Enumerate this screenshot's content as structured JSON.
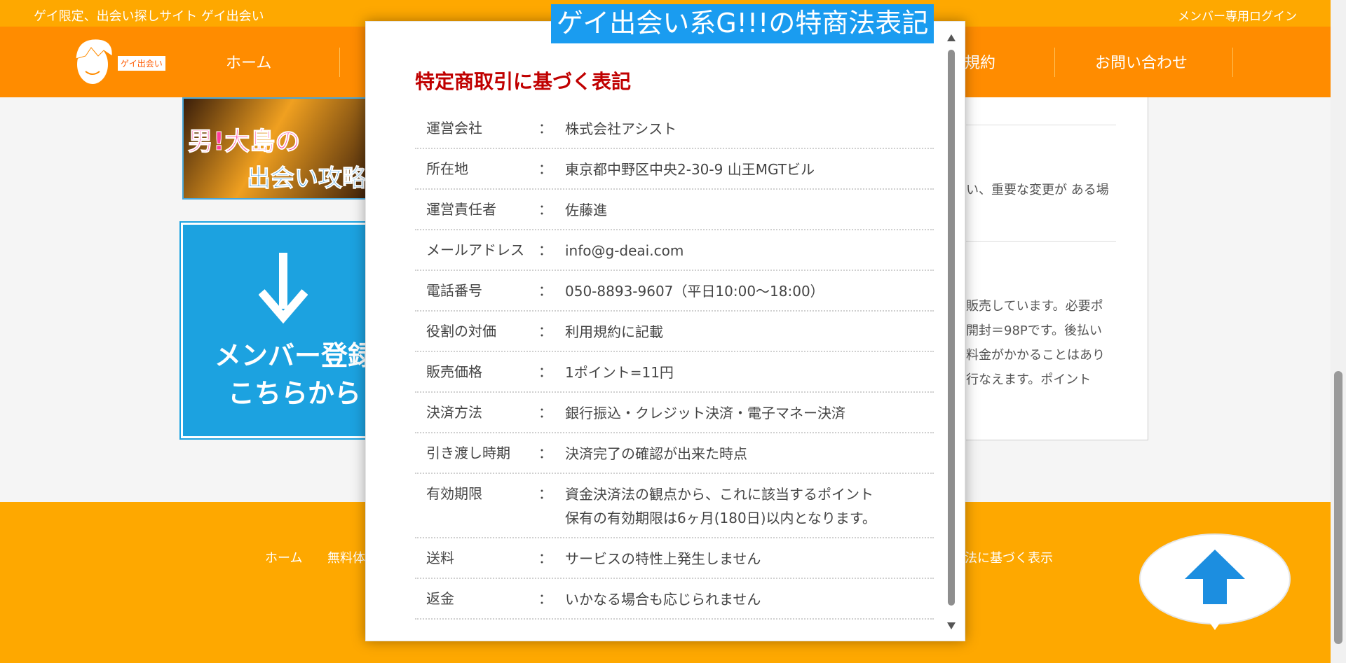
{
  "header": {
    "tagline": "ゲイ限定、出会い探しサイト ゲイ出会い",
    "member_login": "メンバー専用ログイン",
    "logo_label": "ゲイ出会い"
  },
  "nav": {
    "items": [
      "ホーム",
      "規約",
      "お問い合わせ"
    ]
  },
  "sidebar": {
    "banner1_line1": "男!大島の",
    "banner1_line2": "出会い攻略",
    "banner2_line1": "メンバー登録",
    "banner2_line2": "こちらから"
  },
  "content": {
    "line1": "い、重要な変更が ある場",
    "line2": "販売しています。必要ポ",
    "line3": "開封＝98Pです。後払い",
    "line4": "料金がかかることはあり",
    "line5": "行なえます。ポイント"
  },
  "footer": {
    "links": [
      "ホーム",
      "無料体",
      "引法に基づく表示"
    ]
  },
  "modal": {
    "caption": "ゲイ出会い系G!!!の特商法表記",
    "heading": "特定商取引に基づく表記",
    "colon": "：",
    "rows": [
      {
        "key": "運営会社",
        "value": "株式会社アシスト"
      },
      {
        "key": "所在地",
        "value": "東京都中野区中央2-30-9 山王MGTビル"
      },
      {
        "key": "運営責任者",
        "value": "佐藤進"
      },
      {
        "key": "メールアドレス",
        "value": "info@g-deai.com"
      },
      {
        "key": "電話番号",
        "value": "050-8893-9607（平日10:00〜18:00）"
      },
      {
        "key": "役割の対価",
        "value": "利用規約に記載"
      },
      {
        "key": "販売価格",
        "value": "1ポイント=11円"
      },
      {
        "key": "決済方法",
        "value": "銀行振込・クレジット決済・電子マネー決済"
      },
      {
        "key": "引き渡し時期",
        "value": "決済完了の確認が出来た時点"
      },
      {
        "key": "有効期限",
        "value": "資金決済法の観点から、これに該当するポイント\n保有の有効期限は6ヶ月(180日)以内となります。"
      },
      {
        "key": "送料",
        "value": "サービスの特性上発生しません"
      },
      {
        "key": "返金",
        "value": "いかなる場合も応じられません"
      }
    ]
  },
  "colors": {
    "topbar": "#fea800",
    "navbar": "#ff8c00",
    "heading_red": "#c00000",
    "caption_blue": "#1a9cf0",
    "banner_blue": "#1ca2e0"
  }
}
